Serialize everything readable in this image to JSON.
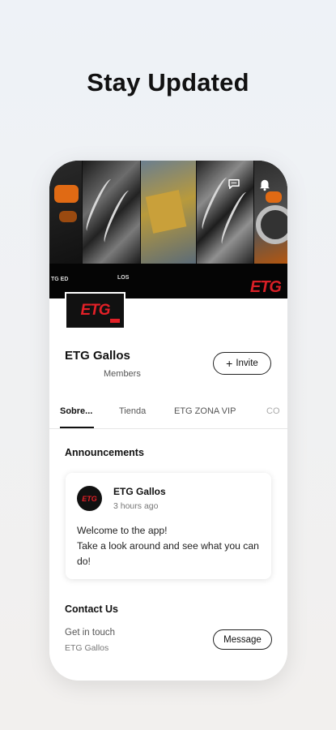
{
  "headline": "Stay Updated",
  "cover": {
    "strip_text_left": "TG ED",
    "strip_text_mid": "LOS",
    "strip_logo": "ETG",
    "icons": [
      "chat-icon",
      "bell-icon"
    ]
  },
  "group": {
    "logo_text": "ETG",
    "name": "ETG Gallos",
    "members_label": "Members",
    "invite_label": "Invite"
  },
  "tabs": [
    {
      "label": "Sobre...",
      "active": true
    },
    {
      "label": "Tienda",
      "active": false
    },
    {
      "label": "ETG ZONA VIP",
      "active": false
    },
    {
      "label": "CO",
      "active": false
    }
  ],
  "announcements": {
    "title": "Announcements",
    "post": {
      "avatar_text": "ETG",
      "author": "ETG Gallos",
      "time": "3 hours ago",
      "line1": "Welcome to the app!",
      "line2": "Take a look around and see what you can do!"
    }
  },
  "contact": {
    "title": "Contact Us",
    "line1": "Get in touch",
    "line2": "ETG Gallos",
    "message_label": "Message"
  },
  "colors": {
    "brand_red": "#e32027",
    "accent_orange": "#e06a14"
  }
}
